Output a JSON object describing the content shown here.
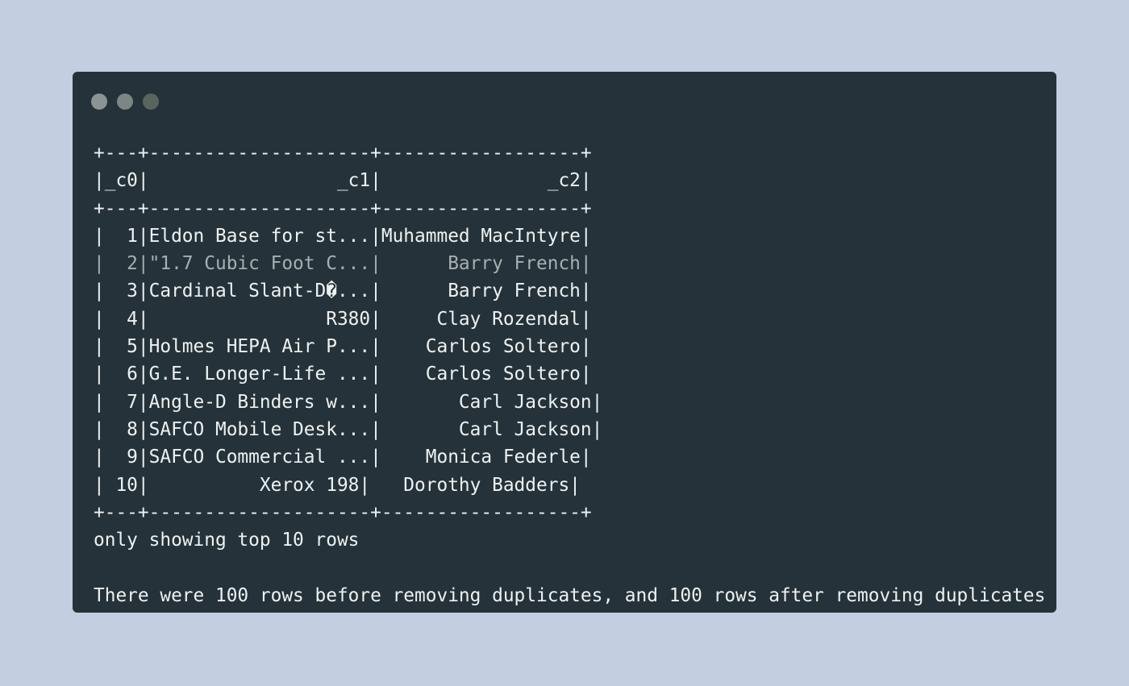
{
  "window": {
    "controls": [
      "close",
      "minimize",
      "zoom"
    ],
    "control_colors": [
      "#8c9493",
      "#7c8685",
      "#59645f"
    ],
    "background": "#26323a",
    "page_background": "#c3cfe0"
  },
  "table": {
    "border_top": "+---+--------------------+------------------+",
    "header_row": "|_c0|                 _c1|               _c2|",
    "border_mid": "+---+--------------------+------------------+",
    "rows": [
      "|  1|Eldon Base for st...|Muhammed MacIntyre|",
      "|  2|\"1.7 Cubic Foot C...|      Barry French|",
      "|  3|Cardinal Slant-D�...|      Barry French|",
      "|  4|                R380|     Clay Rozendal|",
      "|  5|Holmes HEPA Air P...|    Carlos Soltero|",
      "|  6|G.E. Longer-Life ...|    Carlos Soltero|",
      "|  7|Angle-D Binders w...|       Carl Jackson|",
      "|  8|SAFCO Mobile Desk...|       Carl Jackson|",
      "|  9|SAFCO Commercial ...|    Monica Federle|",
      "| 10|          Xerox 198|   Dorothy Badders|"
    ],
    "border_bottom": "+---+--------------------+------------------+"
  },
  "footer_note": "only showing top 10 rows",
  "summary": "There were 100 rows before removing duplicates, and 100 rows after removing duplicates"
}
